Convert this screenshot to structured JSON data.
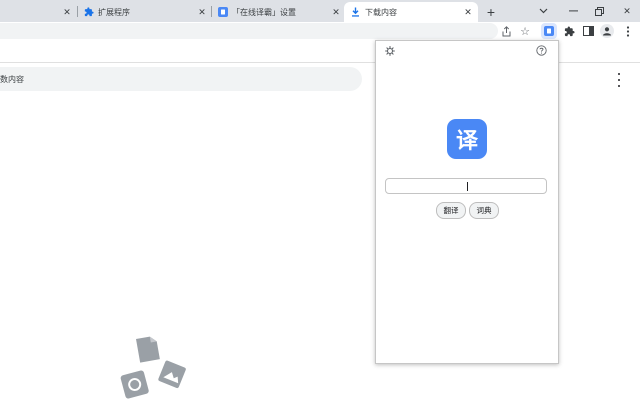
{
  "tabs": [
    {
      "label": "扩展程序"
    },
    {
      "label": "「在线译霸」设置"
    },
    {
      "label": "下载内容"
    }
  ],
  "page": {
    "search_text": "数内容"
  },
  "popup": {
    "logo_char": "译",
    "translate_label": "翻译",
    "dictionary_label": "词典"
  },
  "colors": {
    "tabstrip": "#dee1e6",
    "accent": "#1a73e8",
    "logo_bg": "#4a88f5",
    "searchbar": "#f1f3f4"
  }
}
